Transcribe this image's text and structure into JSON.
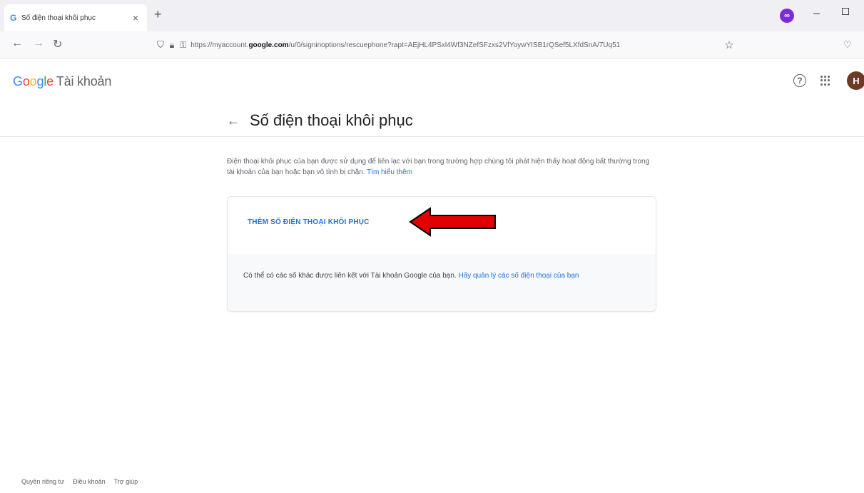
{
  "browser": {
    "tab_favicon": "G",
    "tab_title": "Số điện thoại khôi phục",
    "tab_close": "×",
    "new_tab": "+",
    "url_prefix": "https://myaccount.",
    "url_domain": "google.com",
    "url_suffix": "/u/0/signinoptions/rescuephone?rapt=AEjHL4PSxl4Wf3NZefSFzxs2VfYoywYISB1rQSef5LXfdSnA/7Uq51",
    "extension_label": "∞",
    "icons": [
      "back-arrow-icon",
      "forward-arrow-icon",
      "reload-icon",
      "shield-icon",
      "lock-icon",
      "key-icon",
      "star-icon",
      "pocket-icon"
    ]
  },
  "header": {
    "logo_letters": [
      "G",
      "o",
      "o",
      "g",
      "l",
      "e"
    ],
    "logo_suffix": "Tài khoản",
    "help_glyph": "?",
    "avatar_initial": "H"
  },
  "page": {
    "title": "Số điện thoại khôi phục",
    "description": "Điện thoại khôi phục của bạn được sử dụng để liên lạc với bạn trong trường hợp chúng tôi phát hiện thấy hoạt động bất thường trong tài khoản của bạn hoặc bạn vô tình bị chặn.",
    "learn_more": "Tìm hiểu thêm"
  },
  "card": {
    "add_button": "THÊM SỐ ĐIỆN THOẠI KHÔI PHỤC",
    "note": "Có thể có các số khác được liên kết với Tài khoản Google của bạn.",
    "manage_link": "Hãy quản lý các số điện thoại của bạn"
  },
  "footer": {
    "links": [
      "Quyền riêng tư",
      "Điều khoản",
      "Trợ giúp"
    ]
  },
  "colors": {
    "accent": "#1a73e8",
    "annotation_arrow": "#e00000",
    "avatar_bg": "#6d3a28"
  }
}
